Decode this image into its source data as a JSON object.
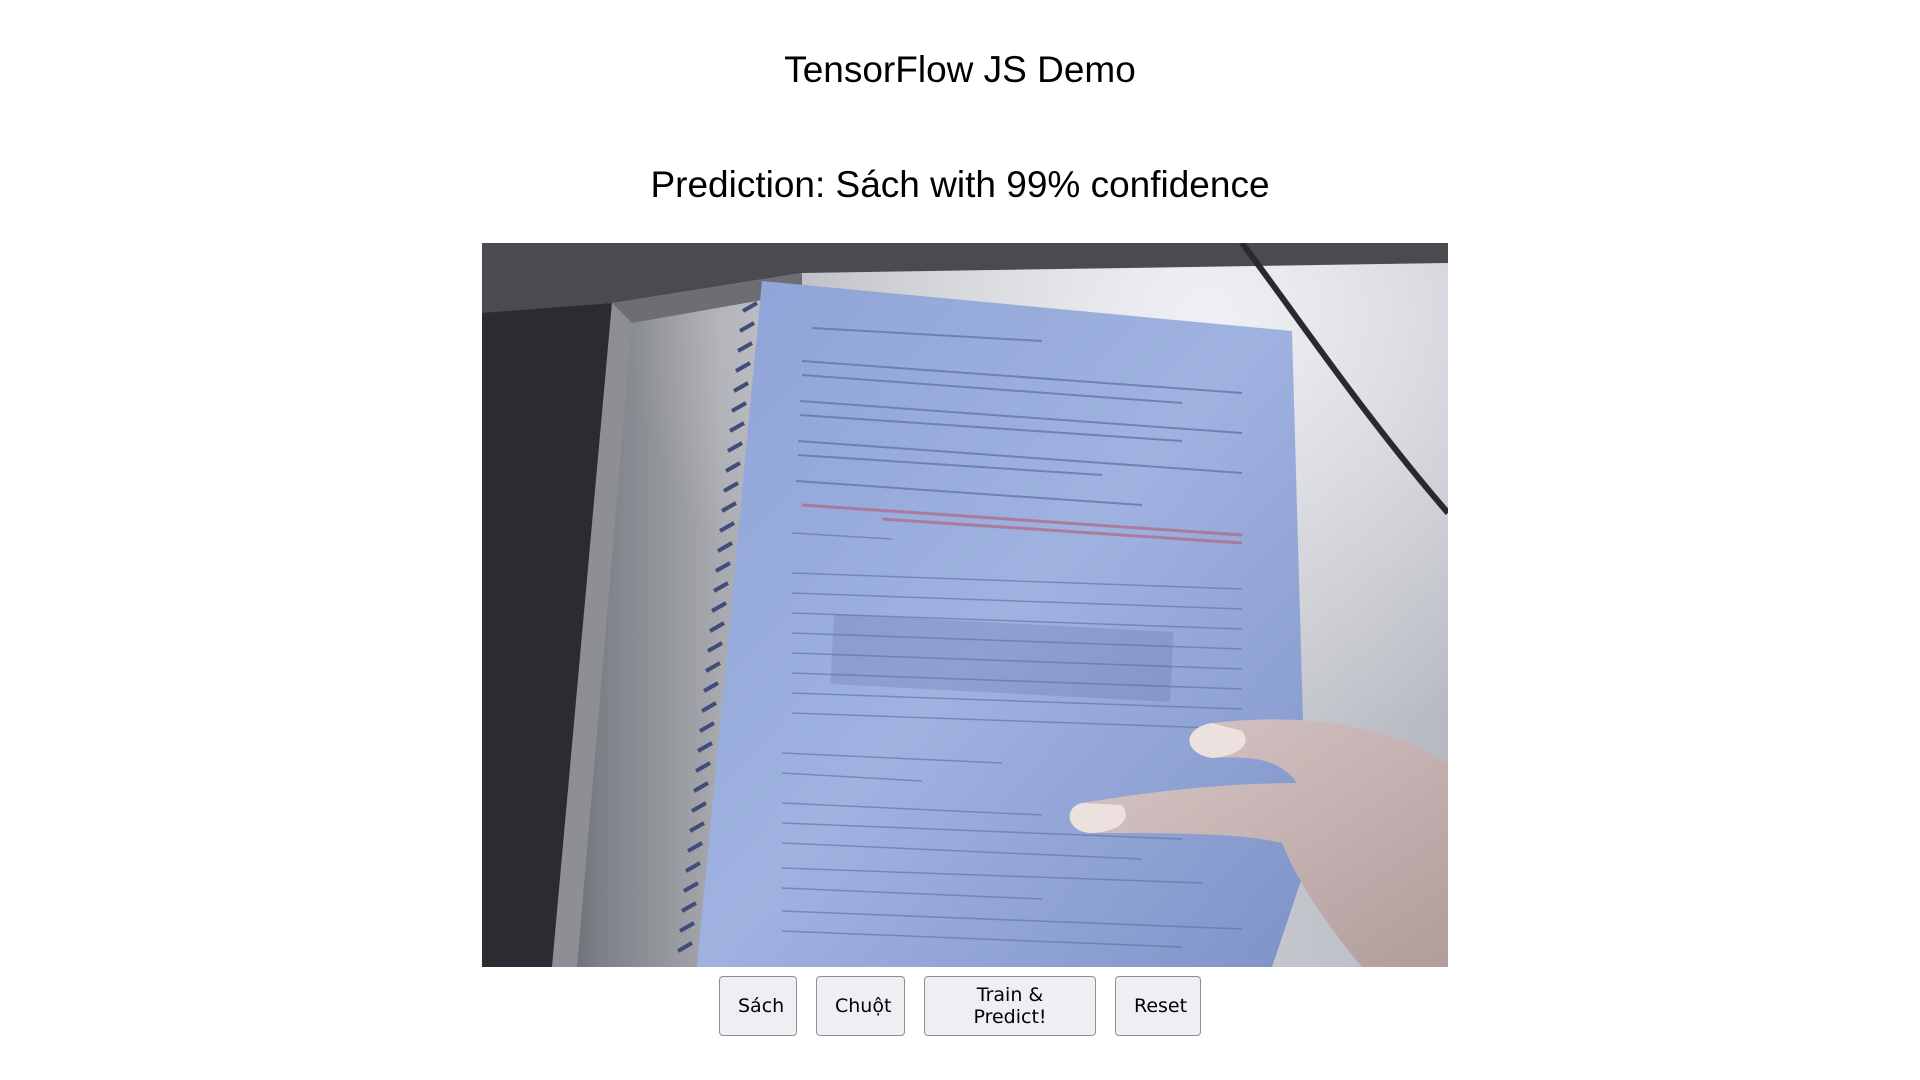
{
  "header": {
    "title": "TensorFlow JS Demo"
  },
  "prediction": {
    "text": "Prediction: Sách with 99% confidence"
  },
  "webcam": {
    "description_icon": "webcam-feed",
    "accent": "#7f93c8"
  },
  "controls": {
    "class1_label": "Sách",
    "class2_label": "Chuột",
    "train_label": "Train & Predict!",
    "reset_label": "Reset"
  }
}
